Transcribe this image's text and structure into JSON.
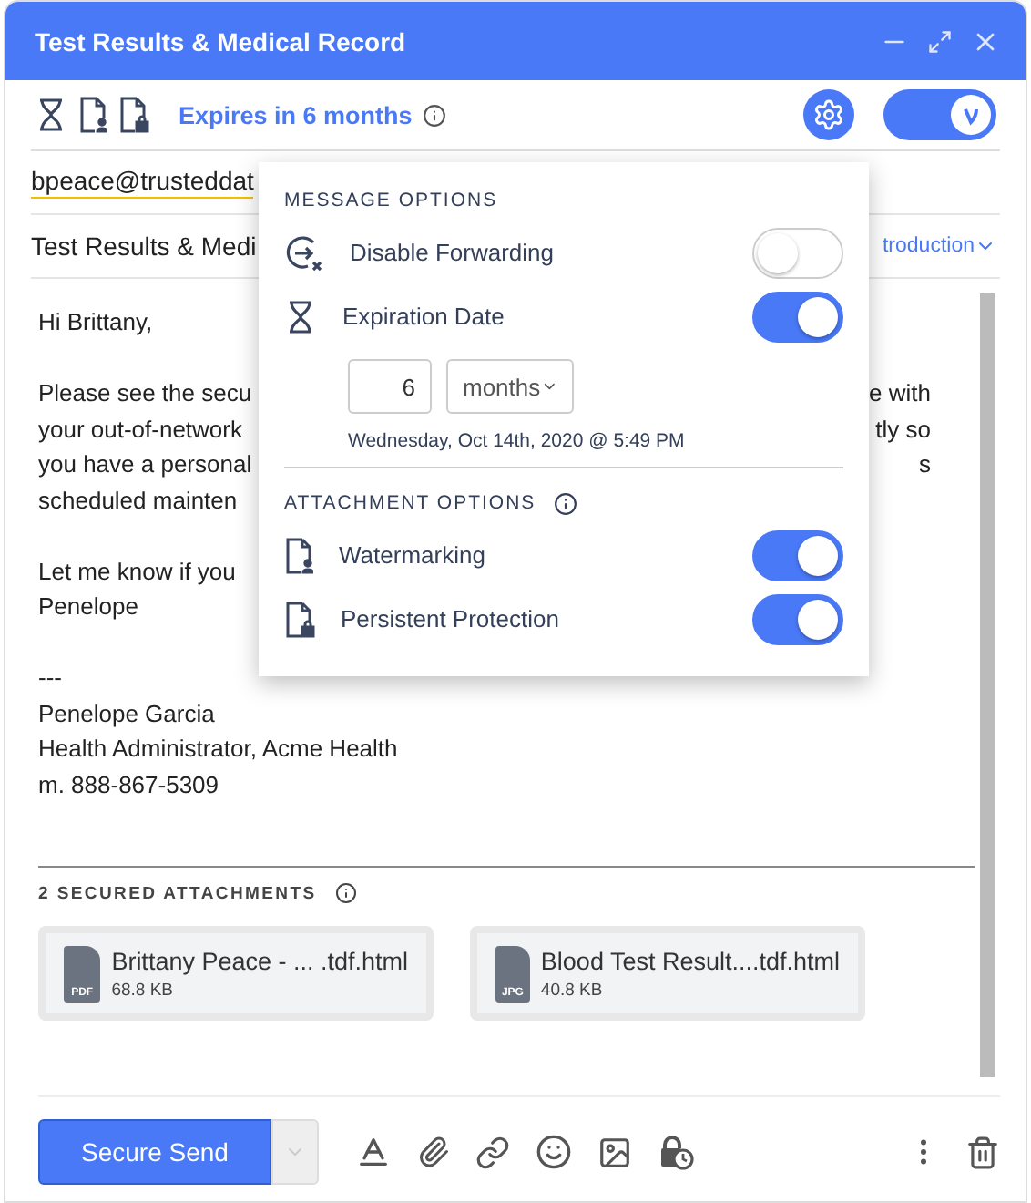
{
  "window": {
    "title": "Test Results & Medical Record"
  },
  "security_bar": {
    "expiry": "Expires in 6 months",
    "secure_on": true
  },
  "recipient": "bpeace@trusteddat",
  "subject": "Test Results & Medi",
  "template_link": "troduction",
  "body": [
    [
      {
        "left": "Hi Brittany,"
      }
    ],
    [
      {
        "left": "Please see the secu",
        "right": "e with"
      },
      {
        "left": "your out-of-network",
        "right": "tly so"
      },
      {
        "left": "you have a personal",
        "right": "s"
      },
      {
        "left": "scheduled mainten"
      }
    ],
    [
      {
        "left": "Let me know if you"
      },
      {
        "left": "Penelope"
      }
    ],
    [
      {
        "left": "---"
      },
      {
        "left": "Penelope Garcia"
      },
      {
        "left": "Health Administrator, Acme Health"
      },
      {
        "left": "m. 888-867-5309"
      }
    ]
  ],
  "options_popup": {
    "message_header": "MESSAGE OPTIONS",
    "message_options": [
      {
        "kind": "forward",
        "label": "Disable Forwarding",
        "on": false
      },
      {
        "kind": "expiry",
        "label": "Expiration Date",
        "on": true
      }
    ],
    "expiry": {
      "amount": "6",
      "unit": "months",
      "date": "Wednesday, Oct 14th, 2020 @ 5:49 PM"
    },
    "attachment_header": "ATTACHMENT OPTIONS",
    "attachment_options": [
      {
        "kind": "watermark",
        "label": "Watermarking",
        "on": true
      },
      {
        "kind": "protect",
        "label": "Persistent Protection",
        "on": true
      }
    ]
  },
  "attachments": {
    "title": "2 SECURED ATTACHMENTS",
    "items": [
      {
        "name": "Brittany Peace - ...  .tdf.html",
        "type": "PDF",
        "size": "68.8 KB"
      },
      {
        "name": "Blood Test Result....tdf.html",
        "type": "JPG",
        "size": "40.8 KB"
      }
    ]
  },
  "send_button": "Secure Send"
}
